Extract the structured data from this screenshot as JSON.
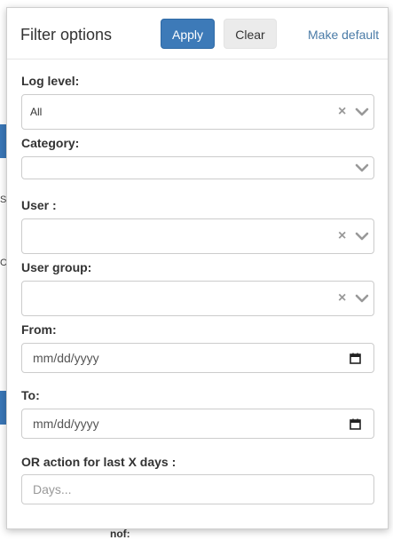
{
  "header": {
    "title": "Filter options",
    "apply_label": "Apply",
    "clear_label": "Clear",
    "make_default_label": "Make default"
  },
  "fields": {
    "log_level": {
      "label": "Log level:",
      "value": "All"
    },
    "category": {
      "label": "Category:",
      "value": ""
    },
    "user": {
      "label": "User :",
      "value": ""
    },
    "user_group": {
      "label": "User group:",
      "value": ""
    },
    "from": {
      "label": "From:",
      "placeholder": "mm/dd/yyyy"
    },
    "to": {
      "label": "To:",
      "placeholder": "mm/dd/yyyy"
    },
    "days": {
      "label": "OR action for last X days :",
      "placeholder": "Days..."
    }
  },
  "background": {
    "fragment_s": "S",
    "fragment_c": "C",
    "fragment_bottom": "nof:"
  },
  "colors": {
    "primary": "#3d7ab8",
    "link": "#4a7ba7",
    "border": "#cccccc",
    "icon_gray": "#999999"
  },
  "icons": [
    "clear-x-icon",
    "chevron-down-icon",
    "calendar-icon"
  ]
}
